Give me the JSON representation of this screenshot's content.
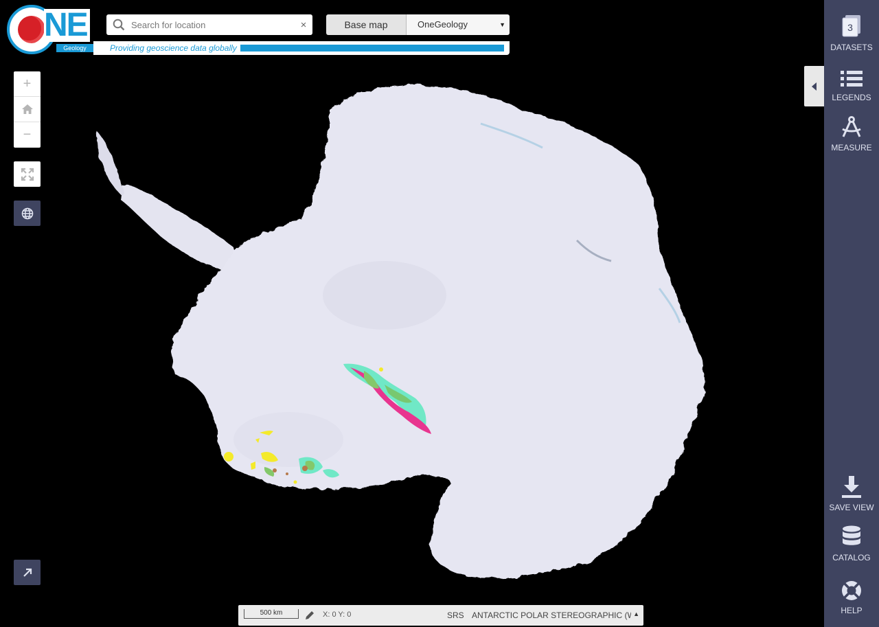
{
  "logo": {
    "text": "NE",
    "subtext": "Geology"
  },
  "search": {
    "placeholder": "Search for location",
    "value": "",
    "clear_glyph": "×"
  },
  "basemap": {
    "label": "Base map",
    "selected": "OneGeology"
  },
  "tagline": "Providing geoscience data globally",
  "zoom": {
    "in": "+",
    "out": "−"
  },
  "sidebar": {
    "datasets_count": "3",
    "items": [
      {
        "label": "DATASETS",
        "icon": "datasets-icon"
      },
      {
        "label": "LEGENDS",
        "icon": "list-icon"
      },
      {
        "label": "MEASURE",
        "icon": "compass-icon"
      },
      {
        "label": "SAVE VIEW",
        "icon": "download-icon"
      },
      {
        "label": "CATALOG",
        "icon": "database-icon"
      },
      {
        "label": "HELP",
        "icon": "lifebuoy-icon"
      }
    ]
  },
  "bottom": {
    "scale": "500 km",
    "coords": "X: 0 Y: 0",
    "srs_label": "SRS",
    "srs_value": "ANTARCTIC POLAR STEREOGRAPHIC (W..."
  },
  "colors": {
    "accent": "#1a9ad6",
    "sidebar": "#3f4460",
    "ice": "#e6e6f2"
  }
}
